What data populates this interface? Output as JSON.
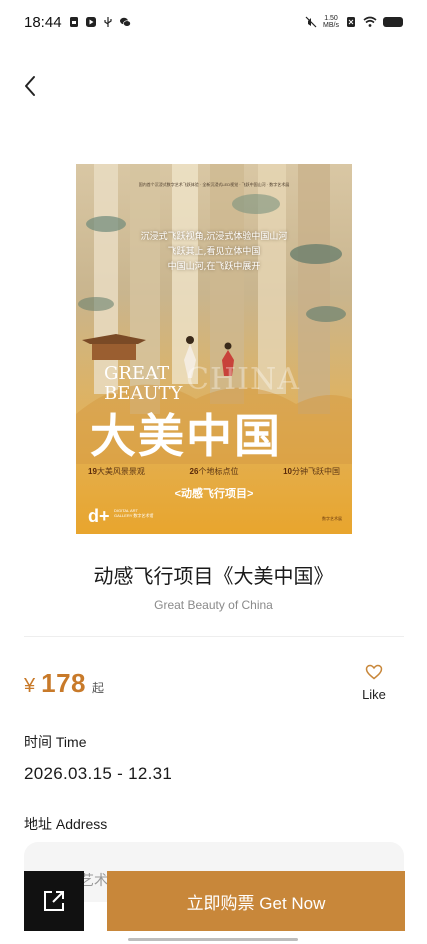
{
  "status_bar": {
    "time": "18:44",
    "net_speed_top": "1.50",
    "net_speed_bottom": "MB/s"
  },
  "poster": {
    "tiny_line": "国内首个沉浸式数字艺术飞跃体验 · 全新沉浸式LED视觉 · 飞跃中国山河 · 数字艺术展",
    "slogan_lines": [
      "沉浸式飞跃视角,沉浸式体验中国山河",
      "飞跃其上,看见立体中国",
      "中国山河,在飞跃中展开"
    ],
    "en_line1": "GREAT",
    "en_line2": "BEAUTY",
    "en_bg": "CHINA",
    "cn_title": "大美中国",
    "stats": [
      {
        "num": "19",
        "text": "大美风景景观"
      },
      {
        "num": "26",
        "text": "个地标点位"
      },
      {
        "num": "10",
        "text": "分钟飞跃中国"
      }
    ],
    "sub_title": "<动感飞行项目>",
    "logo": "d+",
    "logo_text": "DIGITAL ART GALLERY 数字艺术馆",
    "footer_text": "数字艺术展"
  },
  "product": {
    "title": "动感飞行项目《大美中国》",
    "subtitle": "Great Beauty of China"
  },
  "price": {
    "symbol": "¥",
    "value": "178",
    "suffix": "起"
  },
  "like": {
    "label": "Like"
  },
  "time_section": {
    "label": "时间 Time",
    "value": "2026.03.15 - 12.31"
  },
  "address_section": {
    "label": "地址 Address",
    "value": "艺术"
  },
  "actions": {
    "buy_label": "立即购票 Get Now"
  },
  "colors": {
    "accent": "#c8873a",
    "price": "#c87a2a",
    "share_bg": "#111111"
  },
  "icons": {
    "back": "chevron-left-icon",
    "like": "heart-icon",
    "share": "share-external-icon"
  }
}
